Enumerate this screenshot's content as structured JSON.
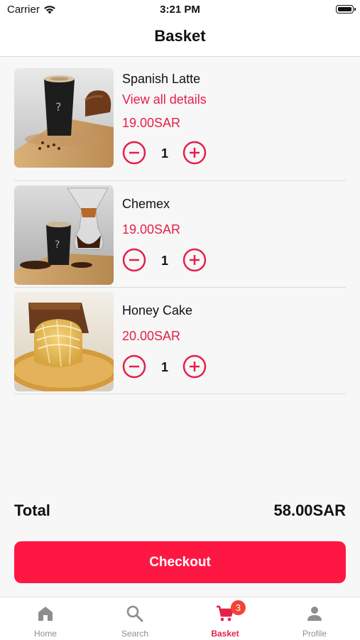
{
  "status_bar": {
    "carrier": "Carrier",
    "time": "3:21 PM",
    "icons": [
      "wifi-icon",
      "battery-icon"
    ]
  },
  "header": {
    "title": "Basket"
  },
  "basket": {
    "items": [
      {
        "name": "Spanish Latte",
        "link": "View all details",
        "price": "19.00SAR",
        "quantity": "1",
        "image": "spanish-latte-photo"
      },
      {
        "name": "Chemex",
        "price": "19.00SAR",
        "quantity": "1",
        "image": "chemex-photo"
      },
      {
        "name": "Honey Cake",
        "price": "20.00SAR",
        "quantity": "1",
        "image": "honey-cake-photo"
      }
    ]
  },
  "summary": {
    "total_label": "Total",
    "total_value": "58.00SAR"
  },
  "checkout": {
    "label": "Checkout"
  },
  "tab_bar": {
    "tabs": [
      {
        "label": "Home",
        "icon": "home-icon",
        "active": false
      },
      {
        "label": "Search",
        "icon": "search-icon",
        "active": false
      },
      {
        "label": "Basket",
        "icon": "cart-icon",
        "active": true,
        "badge": "3"
      },
      {
        "label": "Profile",
        "icon": "person-icon",
        "active": false
      }
    ]
  },
  "colors": {
    "accent": "#e61f4a",
    "button": "#ff1744",
    "badge": "#f44336",
    "inactive": "#8e8e8e"
  }
}
